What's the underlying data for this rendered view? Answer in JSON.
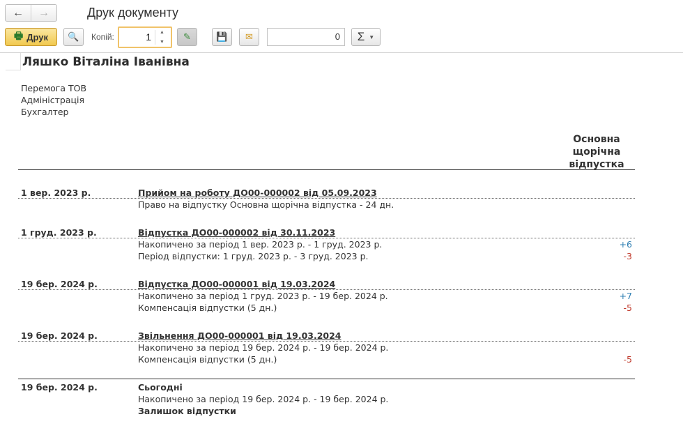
{
  "header": {
    "title": "Друк документу",
    "back_icon": "←",
    "forward_icon": "→"
  },
  "toolbar": {
    "print_label": "Друк",
    "print_icon": "🖶",
    "preview_icon": "🔍",
    "copies_label": "Копій:",
    "copies_value": "1",
    "spin_up": "▲",
    "spin_down": "▼",
    "edit_icon": "✎",
    "save_icon": "💾",
    "mail_icon": "✉",
    "sum_value": "0",
    "sigma_icon": "Σ",
    "sigma_caret": "▼"
  },
  "report": {
    "employee": "Ляшко Віталіна Іванівна",
    "organization": "Перемога ТОВ",
    "department": "Адміністрація",
    "position": "Бухгалтер",
    "column_header": "Основна щорічна відпустка",
    "events": [
      {
        "date": "1 вер. 2023 р.",
        "title": "Прийом на роботу ДО00-000002 від 05.09.2023",
        "lines": [
          {
            "text": "Право на відпустку Основна щорічна відпустка - 24 дн.",
            "value": ""
          }
        ]
      },
      {
        "date": "1 груд. 2023 р.",
        "title": "Відпустка ДО00-000002 від 30.11.2023",
        "lines": [
          {
            "text": "Накопичено за період 1 вер. 2023 р. - 1 груд. 2023 р.",
            "value": "+6"
          },
          {
            "text": "Період відпустки: 1 груд. 2023 р. - 3 груд. 2023 р.",
            "value": "-3"
          }
        ]
      },
      {
        "date": "19 бер. 2024 р.",
        "title": "Відпустка ДО00-000001 від 19.03.2024",
        "lines": [
          {
            "text": "Накопичено за період 1 груд. 2023 р. - 19 бер. 2024 р.",
            "value": "+7"
          },
          {
            "text": "Компенсація відпустки (5 дн.)",
            "value": "-5"
          }
        ]
      },
      {
        "date": "19 бер. 2024 р.",
        "title": "Звільнення ДО00-000001 від 19.03.2024",
        "lines": [
          {
            "text": "Накопичено за період 19 бер. 2024 р. - 19 бер. 2024 р.",
            "value": ""
          },
          {
            "text": "Компенсація відпустки (5 дн.)",
            "value": "-5"
          }
        ]
      }
    ],
    "summary": {
      "date": "19 бер. 2024 р.",
      "title": "Сьогодні",
      "accrued_line": "Накопичено за період 19 бер. 2024 р. - 19 бер. 2024 р.",
      "balance_label": "Залишок відпустки"
    }
  }
}
